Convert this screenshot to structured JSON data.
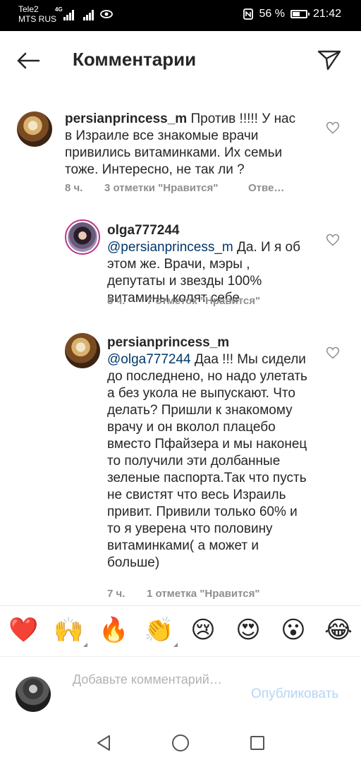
{
  "status_bar": {
    "carrier1": "Tele2",
    "carrier2": "MTS RUS",
    "network": "4G",
    "battery": "56 %",
    "battery_level": 0.56,
    "time": "21:42"
  },
  "header": {
    "title": "Комментарии"
  },
  "comments": [
    {
      "username": "persianprincess_m",
      "text": "Против !!!!! У нас в Израиле все знакомые врачи привились витаминками. Их семьи тоже. Интересно, не так ли ?",
      "time": "8 ч.",
      "likes": "3 отметки \"Нравится\"",
      "reply": "Отве…"
    },
    {
      "username": "olga777244",
      "mention": "@persianprincess_m",
      "text": "Да. И я об этом же. Врачи, мэры , депутаты и звезды 100% витамины колят себе",
      "time": "8 ч.",
      "likes": "7 отметок \"Нравится\""
    },
    {
      "username": "persianprincess_m",
      "mention": "@olga777244",
      "text": "Даа !!! Мы сидели до последнено, но надо улетать а без укола не выпускают. Что делать? Пришли к знакомому  врачу и  он вколол плацебо вместо Пфайзера и мы наконец то получили эти долбанные зеленые паспорта.Так что пусть не свистят что весь Израиль привит. Привили только 60% и то я уверена что половину витаминками( а может и больше)",
      "time": "7 ч.",
      "likes": "1 отметка \"Нравится\""
    }
  ],
  "reactions": [
    "❤️",
    "🙌",
    "🔥",
    "👏",
    "😢",
    "😍",
    "😮",
    "😂"
  ],
  "input": {
    "placeholder": "Добавьте комментарий…",
    "publish_label": "Опубликовать"
  },
  "colors": {
    "text": "#262626",
    "meta": "#8e8e8e",
    "mention": "#00376b",
    "publish_disabled": "#b4d5f5"
  }
}
